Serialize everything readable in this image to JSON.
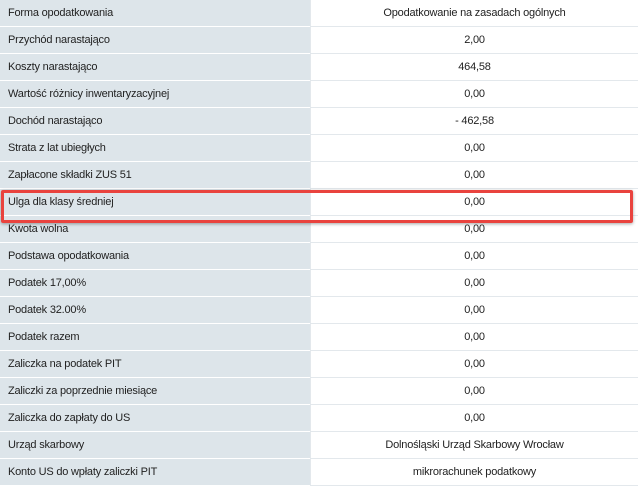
{
  "rows": [
    {
      "label": "Forma opodatkowania",
      "value": "Opodatkowanie na zasadach ogólnych"
    },
    {
      "label": "Przychód narastająco",
      "value": "2,00"
    },
    {
      "label": "Koszty narastająco",
      "value": "464,58"
    },
    {
      "label": "Wartość różnicy inwentaryzacyjnej",
      "value": "0,00"
    },
    {
      "label": "Dochód narastająco",
      "value": "- 462,58"
    },
    {
      "label": "Strata z lat ubiegłych",
      "value": "0,00"
    },
    {
      "label": "Zapłacone składki ZUS 51",
      "value": "0,00"
    },
    {
      "label": "Ulga dla klasy średniej",
      "value": "0,00"
    },
    {
      "label": "Kwota wolna",
      "value": "0,00"
    },
    {
      "label": "Podstawa opodatkowania",
      "value": "0,00"
    },
    {
      "label": "Podatek 17,00%",
      "value": "0,00"
    },
    {
      "label": "Podatek 32.00%",
      "value": "0,00"
    },
    {
      "label": "Podatek razem",
      "value": "0,00"
    },
    {
      "label": "Zaliczka na podatek PIT",
      "value": "0,00"
    },
    {
      "label": "Zaliczki za poprzednie miesiące",
      "value": "0,00"
    },
    {
      "label": "Zaliczka do zapłaty do US",
      "value": "0,00"
    },
    {
      "label": "Urząd skarbowy",
      "value": "Dolnośląski Urząd Skarbowy Wrocław"
    },
    {
      "label": "Konto US do wpłaty zaliczki PIT",
      "value": "mikrorachunek podatkowy"
    }
  ],
  "highlight_color": "#e9433e"
}
